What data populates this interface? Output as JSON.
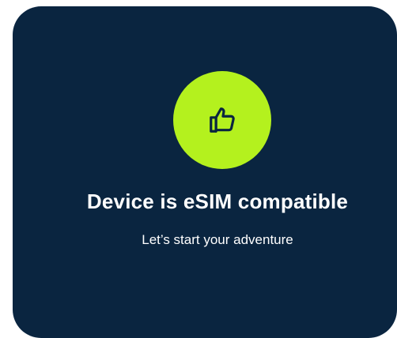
{
  "card": {
    "background_color": "#0a2540",
    "badge": {
      "icon": "thumbs-up-icon",
      "color": "#b4f11e"
    },
    "title": "Device is eSIM compatible",
    "subtitle": "Let’s start your adventure"
  }
}
